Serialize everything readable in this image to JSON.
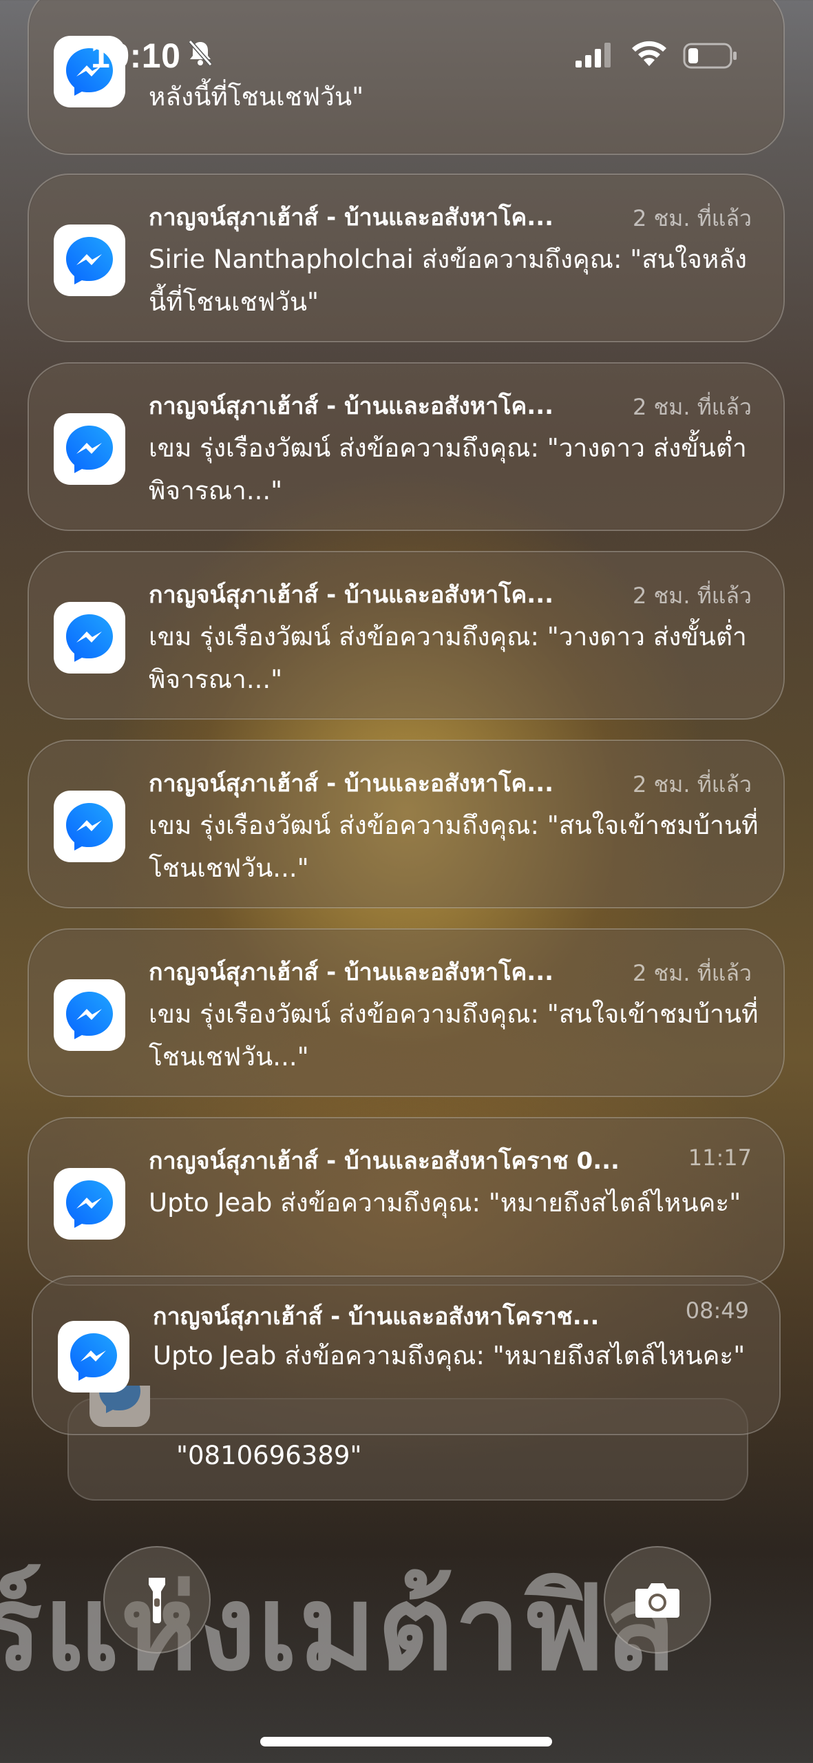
{
  "status_bar": {
    "time": "19:10"
  },
  "notifications": [
    {
      "app": "Messenger",
      "title": "",
      "time": "",
      "body": "หลังนี้ที่โชนเชฟวัน\""
    },
    {
      "app": "Messenger",
      "title": "กาญจน์สุภาเฮ้าส์ - บ้านและอสังหาโค...",
      "time": "2 ชม. ที่แล้ว",
      "body": "Sirie Nanthapholchai ส่งข้อความถึงคุณ: \"สนใจหลังนี้ที่โชนเชฟวัน\""
    },
    {
      "app": "Messenger",
      "title": "กาญจน์สุภาเฮ้าส์ - บ้านและอสังหาโค...",
      "time": "2 ชม. ที่แล้ว",
      "body": "เขม รุ่งเรืองวัฒน์ ส่งข้อความถึงคุณ: \"วางดาว ส่งขั้นต่ำ พิจารณา...\""
    },
    {
      "app": "Messenger",
      "title": "กาญจน์สุภาเฮ้าส์ - บ้านและอสังหาโค...",
      "time": "2 ชม. ที่แล้ว",
      "body": "เขม รุ่งเรืองวัฒน์ ส่งข้อความถึงคุณ: \"วางดาว ส่งขั้นต่ำ พิจารณา...\""
    },
    {
      "app": "Messenger",
      "title": "กาญจน์สุภาเฮ้าส์ - บ้านและอสังหาโค...",
      "time": "2 ชม. ที่แล้ว",
      "body": "เขม รุ่งเรืองวัฒน์ ส่งข้อความถึงคุณ: \"สนใจเข้าชมบ้านที่โชนเชฟวัน...\""
    },
    {
      "app": "Messenger",
      "title": "กาญจน์สุภาเฮ้าส์ - บ้านและอสังหาโค...",
      "time": "2 ชม. ที่แล้ว",
      "body": "เขม รุ่งเรืองวัฒน์ ส่งข้อความถึงคุณ: \"สนใจเข้าชมบ้านที่โชนเชฟวัน...\""
    },
    {
      "app": "Messenger",
      "title": "กาญจน์สุภาเฮ้าส์ - บ้านและอสังหาโคราช 0...",
      "time": "11:17",
      "body": "Upto Jeab ส่งข้อความถึงคุณ: \"หมายถึงสไตล์ไหนคะ\""
    },
    {
      "app": "Messenger",
      "title": "กาญจน์สุภาเฮ้าส์ - บ้านและอสังหาโคราช...",
      "time": "08:49",
      "body": "Upto Jeab ส่งข้อความถึงคุณ: \"หมายถึงสไตล์ไหนคะ\""
    }
  ],
  "stack_peek": {
    "text": "\"0810696389\""
  },
  "wallpaper_text": "ร์แห่งเมต้าฟิส",
  "colors": {
    "messenger_blue": "#1a8cff",
    "messenger_gradient_end": "#0866ff"
  }
}
